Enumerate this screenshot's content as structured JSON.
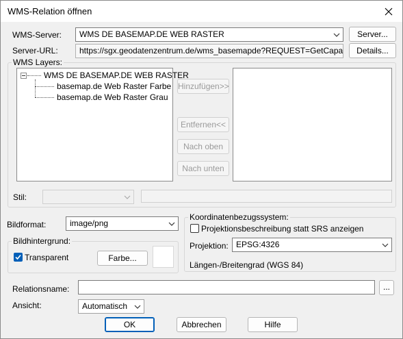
{
  "window": {
    "title": "WMS-Relation öffnen"
  },
  "server": {
    "label": "WMS-Server:",
    "value": "WMS DE BASEMAP.DE WEB RASTER",
    "button": "Server..."
  },
  "url": {
    "label": "Server-URL:",
    "value": "https://sgx.geodatenzentrum.de/wms_basemapde?REQUEST=GetCapabilities&V",
    "button": "Details..."
  },
  "layers": {
    "label": "WMS Layers:",
    "root": "WMS DE BASEMAP.DE WEB RASTER",
    "children": [
      "basemap.de Web Raster Farbe",
      "basemap.de Web Raster Grau"
    ],
    "add_button": "Hinzufügen>>",
    "remove_button": "Entfernen<<",
    "up_button": "Nach oben",
    "down_button": "Nach unten",
    "style_label": "Stil:"
  },
  "image": {
    "format_label": "Bildformat:",
    "format_value": "image/png",
    "background_group": "Bildhintergrund:",
    "transparent_label": "Transparent",
    "transparent_checked": true,
    "color_button": "Farbe..."
  },
  "crs": {
    "group": "Koordinatenbezugssystem:",
    "checkbox_label": "Projektionsbeschreibung statt SRS anzeigen",
    "projection_label": "Projektion:",
    "projection_value": "EPSG:4326",
    "description": "Längen-/Breitengrad (WGS 84)"
  },
  "relation": {
    "name_label": "Relationsname:",
    "name_value": "",
    "browse_button": "...",
    "view_label": "Ansicht:",
    "view_value": "Automatisch"
  },
  "footer": {
    "ok": "OK",
    "cancel": "Abbrechen",
    "help": "Hilfe"
  },
  "colors": {
    "accent": "#005fb8",
    "dialog_bg": "#f0f0f0"
  }
}
